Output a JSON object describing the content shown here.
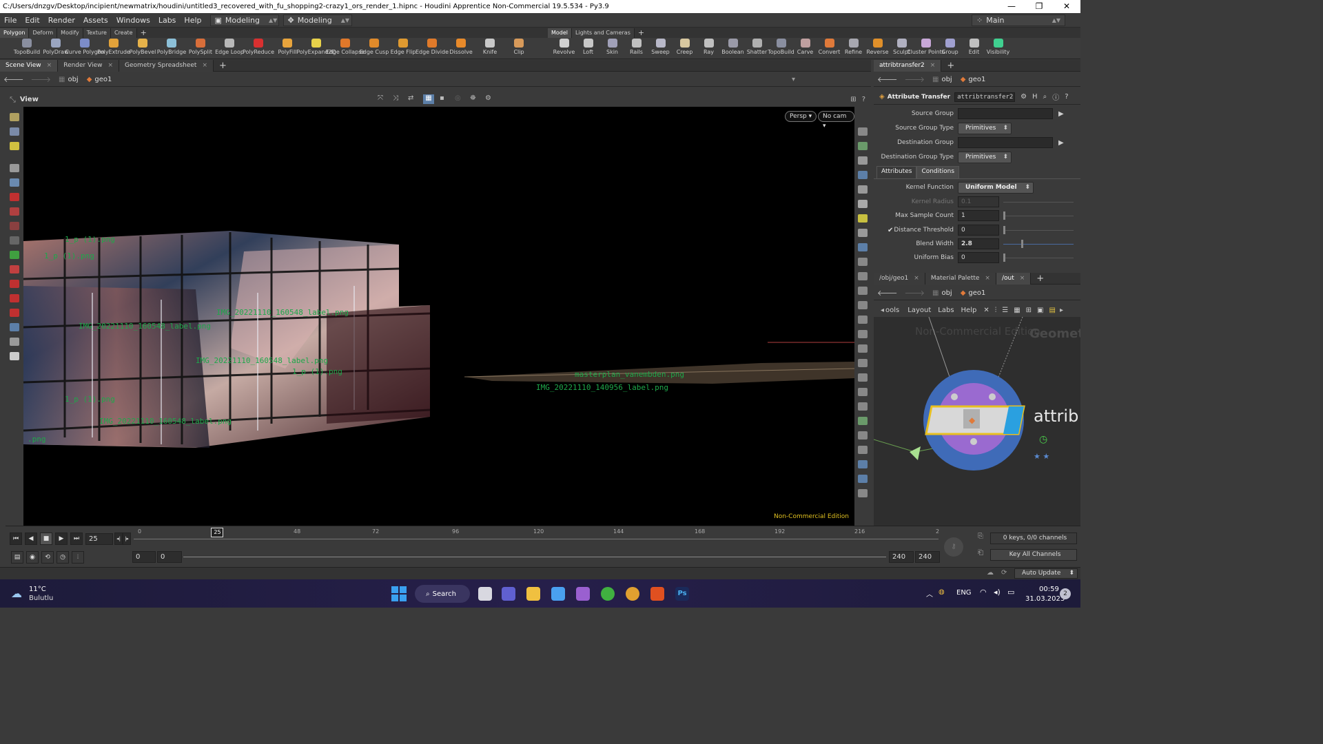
{
  "window": {
    "title": "C:/Users/dnzgv/Desktop/incipient/newmatrix/houdini/untitled3_recovered_with_fu_shopping2-crazy1_ors_render_1.hipnc - Houdini Apprentice Non-Commercial 19.5.534 - Py3.9",
    "minimize": "—",
    "maximize": "❐",
    "close": "✕"
  },
  "menubar": {
    "items": [
      "File",
      "Edit",
      "Render",
      "Assets",
      "Windows",
      "Labs",
      "Help"
    ],
    "desktop1": "Modeling",
    "desktop2": "Modeling",
    "main_label": "Main"
  },
  "shelf": {
    "tabs_left": [
      "Polygon",
      "Deform",
      "Modify",
      "Texture",
      "Create"
    ],
    "tabs_right": [
      "Model",
      "Lights and Cameras"
    ],
    "tools_left": [
      {
        "label": "TopoBuild",
        "color": "#8a8fa0"
      },
      {
        "label": "PolyDraw",
        "color": "#9aa5c0"
      },
      {
        "label": "Curve Polygon",
        "color": "#7c8cc8"
      },
      {
        "label": "PolyExtrude",
        "color": "#e2a23a"
      },
      {
        "label": "PolyBevel",
        "color": "#e6b24a"
      },
      {
        "label": "PolyBridge",
        "color": "#8cc0d8"
      },
      {
        "label": "PolySplit",
        "color": "#d86e3a"
      },
      {
        "label": "Edge Loop",
        "color": "#b8b8b8"
      },
      {
        "label": "PolyReduce",
        "color": "#d83030"
      },
      {
        "label": "PolyFill",
        "color": "#e8a43c"
      },
      {
        "label": "PolyExpand2D",
        "color": "#e8d24a"
      },
      {
        "label": "Edge Collapse",
        "color": "#e0782a"
      },
      {
        "label": "Edge Cusp",
        "color": "#e08a2a"
      },
      {
        "label": "Edge Flip",
        "color": "#e09a30"
      },
      {
        "label": "Edge Divide",
        "color": "#e07a2a"
      },
      {
        "label": "Dissolve",
        "color": "#e88a2a"
      },
      {
        "label": "Knife",
        "color": "#c8c8c8"
      },
      {
        "label": "Clip",
        "color": "#d89a5a"
      }
    ],
    "tools_right": [
      {
        "label": "Revolve",
        "color": "#d0d0d0"
      },
      {
        "label": "Loft",
        "color": "#c8c8c8"
      },
      {
        "label": "Skin",
        "color": "#a0a0b8"
      },
      {
        "label": "Rails",
        "color": "#c0c0c0"
      },
      {
        "label": "Sweep",
        "color": "#b8b8c8"
      },
      {
        "label": "Creep",
        "color": "#d8c8a0"
      },
      {
        "label": "Ray",
        "color": "#c0c0c0"
      },
      {
        "label": "Boolean",
        "color": "#9a9aa8"
      },
      {
        "label": "Shatter",
        "color": "#b0b0b0"
      },
      {
        "label": "TopoBuild",
        "color": "#8a8fa0"
      },
      {
        "label": "Carve",
        "color": "#c0a0a0"
      },
      {
        "label": "Convert",
        "color": "#e07a3a"
      },
      {
        "label": "Refine",
        "color": "#a8a8b0"
      },
      {
        "label": "Reverse",
        "color": "#e0902a"
      },
      {
        "label": "Sculpt",
        "color": "#b0b0c0"
      },
      {
        "label": "Cluster Points",
        "color": "#c8a8d8"
      },
      {
        "label": "Group",
        "color": "#a0a0d0"
      },
      {
        "label": "Edit",
        "color": "#c0c0c0"
      },
      {
        "label": "Visibility",
        "color": "#40d090"
      }
    ]
  },
  "left_pane": {
    "tabs": [
      "Scene View",
      "Render View",
      "Geometry Spreadsheet"
    ],
    "path": [
      "obj",
      "geo1"
    ],
    "view_label": "View",
    "persp_button": "Persp",
    "cam_button": "No cam",
    "watermark": "Non-Commercial Edition",
    "viewport_labels": [
      "1_p (1).png",
      "1_p (1).png",
      "IMG_20221110_160548_label.png",
      "IMG_20221110_160548_label.png",
      "IMG_20221110_160548_label.png",
      "1_p (1).png",
      "masterplan_vanembden.png",
      "IMG_20221110_140956_label.png",
      "1_p (1).png",
      "IMG_20221110_160548_label.png",
      ".png"
    ]
  },
  "timeline": {
    "current_frame": "25",
    "frame_marker": "25",
    "ticks": [
      "0",
      "48",
      "72",
      "96",
      "120",
      "144",
      "168",
      "192",
      "216",
      "2"
    ],
    "range_start_a": "0",
    "range_start_b": "0",
    "range_end_a": "240",
    "range_end_b": "240",
    "playhead_fraction": 0.104,
    "keys_info": "0 keys, 0/0 channels",
    "key_all": "Key All Channels",
    "auto_update": "Auto Update"
  },
  "param_pane": {
    "tab": "attribtransfer2",
    "path": [
      "obj",
      "geo1"
    ],
    "node_type": "Attribute Transfer",
    "node_name": "attribtransfer2",
    "source_group_label": "Source Group",
    "source_group_value": "",
    "source_group_type_label": "Source Group Type",
    "source_group_type_value": "Primitives",
    "dest_group_label": "Destination Group",
    "dest_group_value": "",
    "dest_group_type_label": "Destination Group Type",
    "dest_group_type_value": "Primitives",
    "subtabs": [
      "Attributes",
      "Conditions"
    ],
    "kernel_function_label": "Kernel Function",
    "kernel_function_value": "Uniform Model",
    "kernel_radius_label": "Kernel Radius",
    "kernel_radius_value": "0.1",
    "max_sample_label": "Max Sample Count",
    "max_sample_value": "1",
    "distance_threshold_label": "Distance Threshold",
    "distance_threshold_value": "0",
    "distance_threshold_checked": "✔",
    "blend_width_label": "Blend Width",
    "blend_width_value": "2.8",
    "uniform_bias_label": "Uniform Bias",
    "uniform_bias_value": "0"
  },
  "network_pane": {
    "tabs": [
      "/obj/geo1",
      "Material Palette",
      "/out"
    ],
    "path": [
      "obj",
      "geo1"
    ],
    "menu": [
      "ools",
      "Layout",
      "Labs",
      "Help"
    ],
    "watermark": "Non-Commercial Edition",
    "context_label": "Geometry",
    "node_label": "attrib"
  },
  "taskbar": {
    "weather_temp": "11°C",
    "weather_desc": "Bulutlu",
    "search": "Search",
    "lang": "ENG",
    "time": "00:59",
    "date": "31.03.2023",
    "notif_count": "2"
  }
}
